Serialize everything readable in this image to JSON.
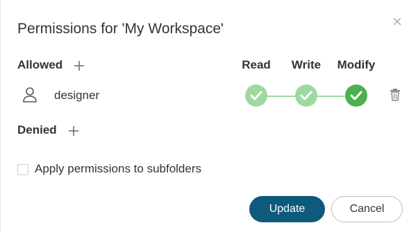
{
  "dialog": {
    "title": "Permissions for 'My Workspace'",
    "close_icon": "close-icon"
  },
  "allowed": {
    "label": "Allowed",
    "add_icon": "plus-icon",
    "columns": [
      "Read",
      "Write",
      "Modify"
    ],
    "users": [
      {
        "name": "designer",
        "icon": "user-icon",
        "permissions": {
          "read": true,
          "write": true,
          "modify": true
        },
        "delete_icon": "trash-icon"
      }
    ]
  },
  "denied": {
    "label": "Denied",
    "add_icon": "plus-icon"
  },
  "options": {
    "apply_subfolders_label": "Apply permissions to subfolders",
    "apply_subfolders_checked": false
  },
  "buttons": {
    "update": "Update",
    "cancel": "Cancel"
  },
  "colors": {
    "check_light": "#9fd8a0",
    "check_dark": "#4cb050",
    "primary": "#0d5a7a",
    "text": "#333333"
  }
}
